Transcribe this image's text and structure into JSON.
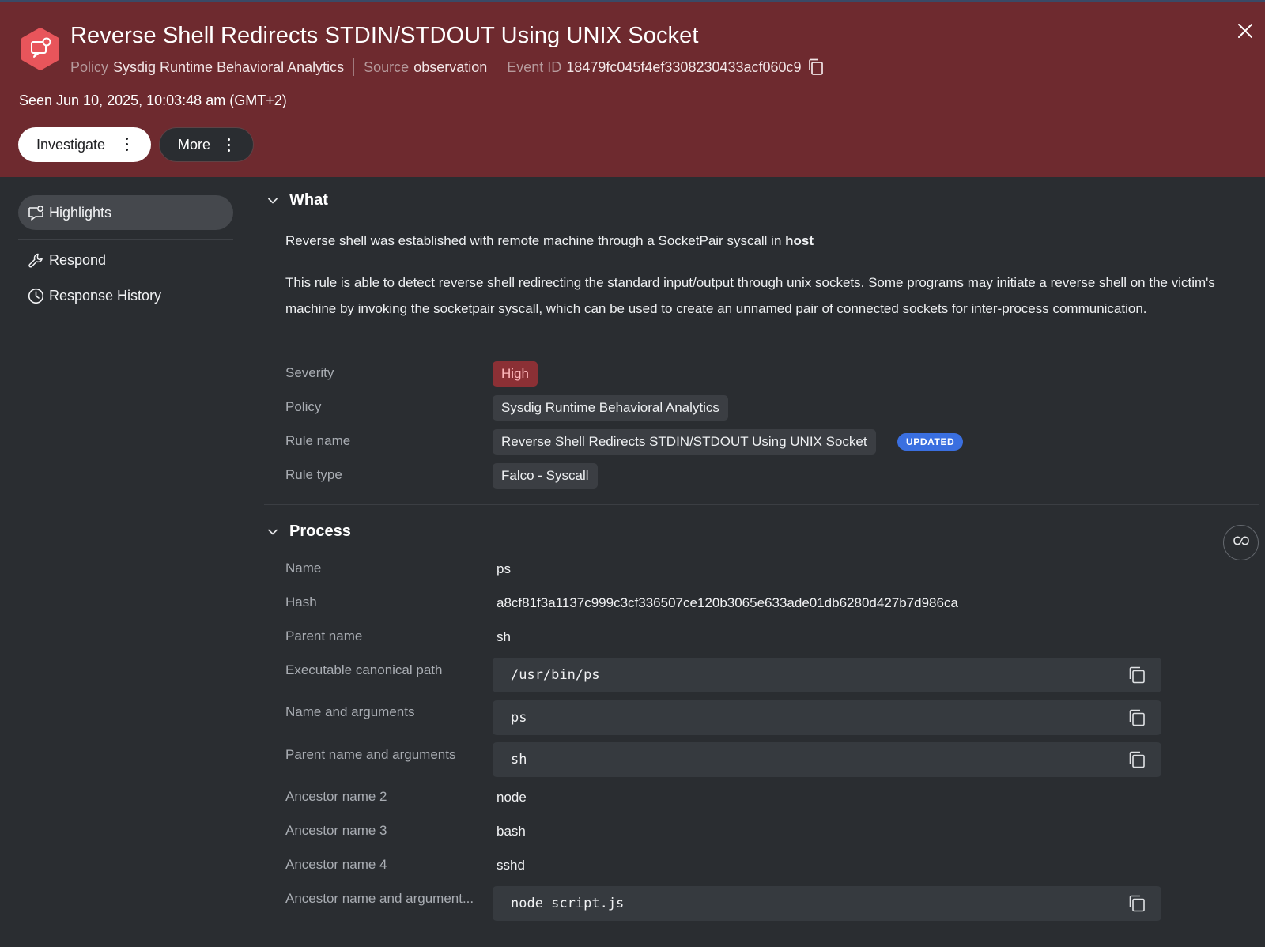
{
  "header": {
    "title": "Reverse Shell Redirects STDIN/STDOUT Using UNIX Socket",
    "policy_label": "Policy",
    "policy_value": "Sysdig Runtime Behavioral Analytics",
    "source_label": "Source",
    "source_value": "observation",
    "event_id_label": "Event ID",
    "event_id_value": "18479fc045f4ef3308230433acf060c9",
    "seen": "Seen Jun 10, 2025, 10:03:48 am (GMT+2)",
    "investigate_label": "Investigate",
    "more_label": "More",
    "icons": {
      "brand": "alert-chat-icon",
      "close": "close-icon",
      "copy": "copy-icon",
      "kebab": "kebab-icon"
    },
    "colors": {
      "banner": "#6e2a2f",
      "brand_icon": "#e8555b"
    }
  },
  "sidebar": {
    "items": [
      {
        "label": "Highlights",
        "icon": "highlights-icon",
        "active": true
      },
      {
        "label": "Respond",
        "icon": "wrench-icon",
        "active": false
      },
      {
        "label": "Response History",
        "icon": "clock-icon",
        "active": false
      }
    ]
  },
  "what": {
    "title": "What",
    "summary_prefix": "Reverse shell was established with remote machine through a SocketPair syscall in",
    "summary_bold": "host",
    "description": "This rule is able to detect reverse shell redirecting the standard input/output through unix sockets. Some programs may initiate a reverse shell on the victim's machine by invoking the socketpair syscall, which can be used to create an unnamed pair of connected sockets for inter-process communication.",
    "fields": {
      "severity_label": "Severity",
      "severity_value": "High",
      "policy_label": "Policy",
      "policy_value": "Sysdig Runtime Behavioral Analytics",
      "rule_name_label": "Rule name",
      "rule_name_value": "Reverse Shell Redirects STDIN/STDOUT Using UNIX Socket",
      "rule_badge": "UPDATED",
      "rule_type_label": "Rule type",
      "rule_type_value": "Falco - Syscall"
    },
    "colors": {
      "severity_high": "#8b3035",
      "badge": "#3a6fe0"
    }
  },
  "process": {
    "title": "Process",
    "link_icon": "link-icon",
    "rows": {
      "name_label": "Name",
      "name_value": "ps",
      "hash_label": "Hash",
      "hash_value": "a8cf81f3a1137c999c3cf336507ce120b3065e633ade01db6280d427b7d986ca",
      "parent_label": "Parent name",
      "parent_value": "sh",
      "exe_label": "Executable canonical path",
      "exe_value": "/usr/bin/ps",
      "nameargs_label": "Name and arguments",
      "nameargs_value": "ps",
      "parentargs_label": "Parent name and arguments",
      "parentargs_value": "sh",
      "anc2_label": "Ancestor name 2",
      "anc2_value": "node",
      "anc3_label": "Ancestor name 3",
      "anc3_value": "bash",
      "anc4_label": "Ancestor name 4",
      "anc4_value": "sshd",
      "ancargs_label": "Ancestor name and argument...",
      "ancargs_value": "node script.js"
    }
  }
}
